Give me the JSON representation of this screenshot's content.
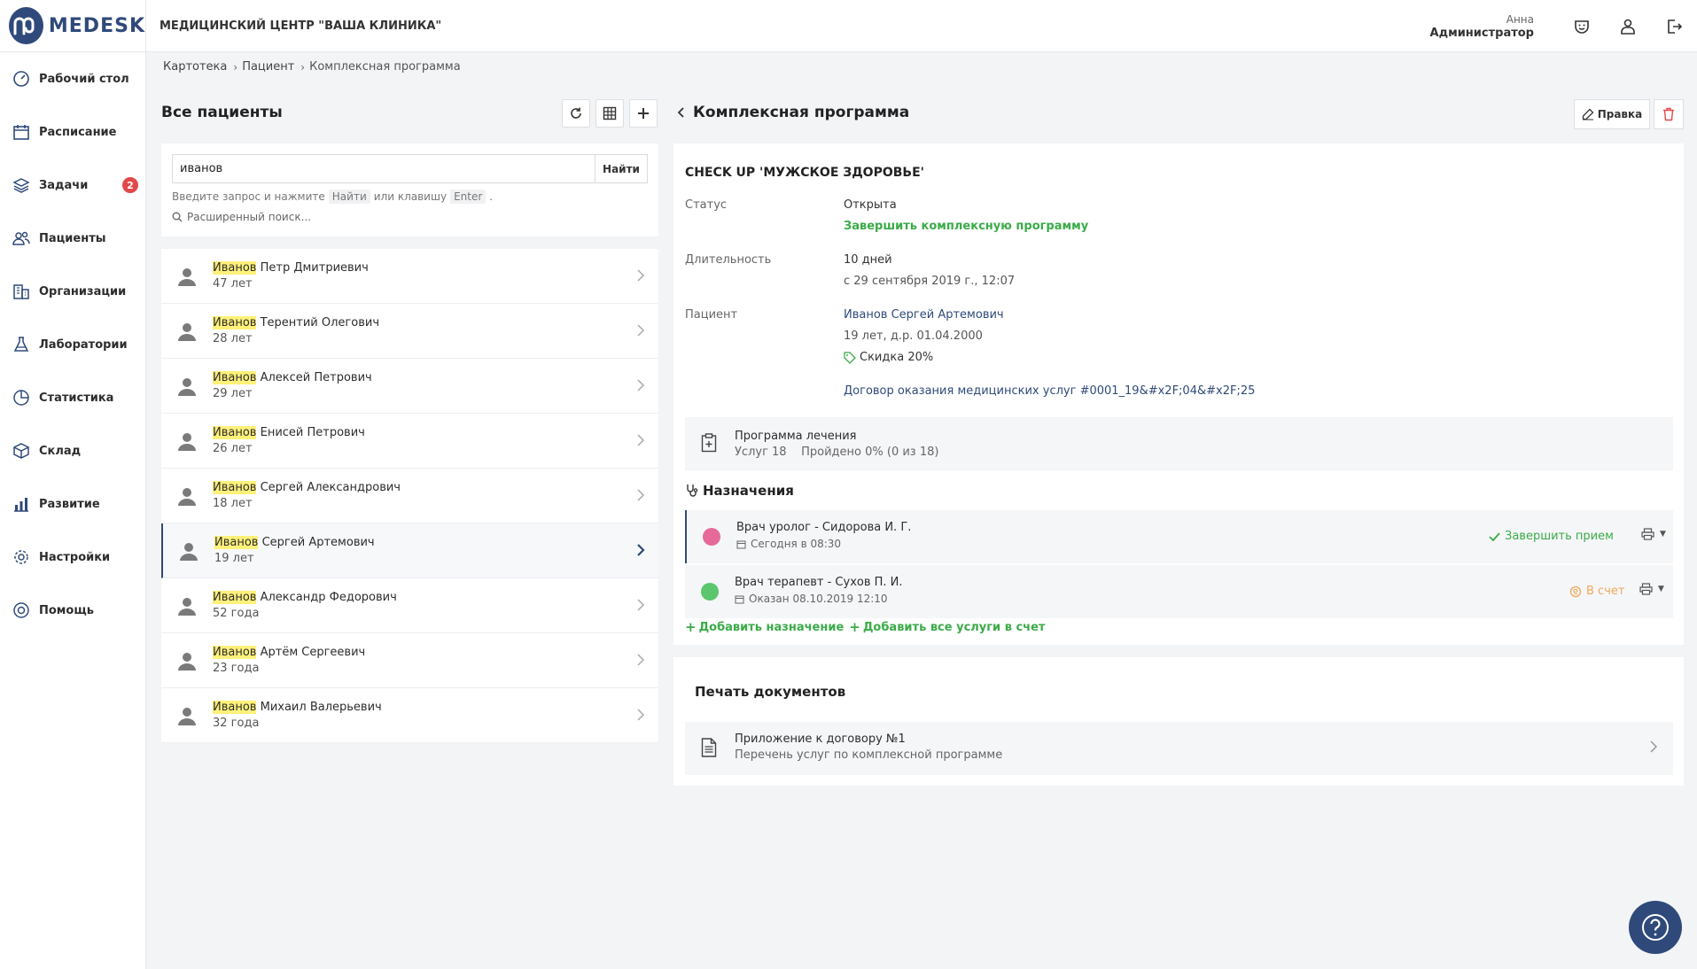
{
  "header": {
    "logo_text": "MEDESK",
    "clinic_name": "МЕДИЦИНСКИЙ ЦЕНТР \"ВАША КЛИНИКА\"",
    "user_first_name": "Анна",
    "user_role": "Администратор"
  },
  "sidebar": {
    "items": [
      {
        "label": "Рабочий стол",
        "icon": "dashboard-icon"
      },
      {
        "label": "Расписание",
        "icon": "calendar-icon"
      },
      {
        "label": "Задачи",
        "icon": "layers-icon",
        "badge": "2"
      },
      {
        "label": "Пациенты",
        "icon": "users-icon"
      },
      {
        "label": "Организации",
        "icon": "building-icon"
      },
      {
        "label": "Лаборатории",
        "icon": "lab-icon"
      },
      {
        "label": "Статистика",
        "icon": "pie-chart-icon"
      },
      {
        "label": "Склад",
        "icon": "box-icon"
      },
      {
        "label": "Развитие",
        "icon": "bar-chart-icon"
      },
      {
        "label": "Настройки",
        "icon": "gear-icon"
      },
      {
        "label": "Помощь",
        "icon": "lifebuoy-icon"
      }
    ]
  },
  "breadcrumb": [
    "Картотека",
    "Пациент",
    "Комплексная программа"
  ],
  "patients": {
    "title": "Все пациенты",
    "search_value": "иванов",
    "search_button": "Найти",
    "hint_before": "Введите запрос и нажмите",
    "hint_key1": "Найти",
    "hint_mid": "или клавишу",
    "hint_key2": "Enter",
    "hint_end": ".",
    "advanced_search": "Расширенный поиск...",
    "rows": [
      {
        "surname": "Иванов",
        "rest": " Петр Дмитриевич",
        "age": "47 лет"
      },
      {
        "surname": "Иванов",
        "rest": " Терентий Олегович",
        "age": "28 лет"
      },
      {
        "surname": "Иванов",
        "rest": " Алексей Петрович",
        "age": "29 лет"
      },
      {
        "surname": "Иванов",
        "rest": " Енисей Петрович",
        "age": "26 лет"
      },
      {
        "surname": "Иванов",
        "rest": " Сергей Александрович",
        "age": "18 лет"
      },
      {
        "surname": "Иванов",
        "rest": " Сергей Артемович",
        "age": "19 лет",
        "active": true
      },
      {
        "surname": "Иванов",
        "rest": " Александр Федорович",
        "age": "52 года"
      },
      {
        "surname": "Иванов",
        "rest": " Артём Сергеевич",
        "age": "23 года"
      },
      {
        "surname": "Иванов",
        "rest": " Михаил Валерьевич",
        "age": "32 года"
      }
    ]
  },
  "program": {
    "title": "Комплексная программа",
    "edit_label": "Правка",
    "name": "CHECK UP 'МУЖСКОЕ ЗДОРОВЬЕ'",
    "status_label": "Статус",
    "status_value": "Открыта",
    "finish_link": "Завершить комплексную программу",
    "duration_label": "Длительность",
    "duration_value": "10 дней",
    "duration_since": "с 29 сентября 2019 г., 12:07",
    "patient_label": "Пациент",
    "patient_name": "Иванов Сергей Артемович",
    "patient_age": "19 лет, д.р. 01.04.2000",
    "discount": "Скидка 20%",
    "contract": "Договор оказания медицинских услуг #0001_19&#x2F;04&#x2F;25",
    "plan_title": "Программа лечения",
    "plan_services": "Услуг 18",
    "plan_progress": "Пройдено 0% (0 из 18)",
    "appointments_title": "Назначения",
    "appointments": [
      {
        "title": "Врач уролог - Сидорова И. Г.",
        "date": "Сегодня в 08:30",
        "action": "Завершить прием",
        "dot_color": "#e56a9a",
        "action_color": "#3bab48"
      },
      {
        "title": "Врач терапевт - Сухов П. И.",
        "date": "Оказан 08.10.2019 12:10",
        "action": "В счет",
        "dot_color": "#5cc66d",
        "action_color": "#f0a85a"
      }
    ],
    "add_appointment": "Добавить назначение",
    "add_all_services": "Добавить все услуги в счет"
  },
  "docs": {
    "title": "Печать документов",
    "doc_title": "Приложение к договору №1",
    "doc_subtitle": "Перечень услуг по комплексной программе"
  }
}
